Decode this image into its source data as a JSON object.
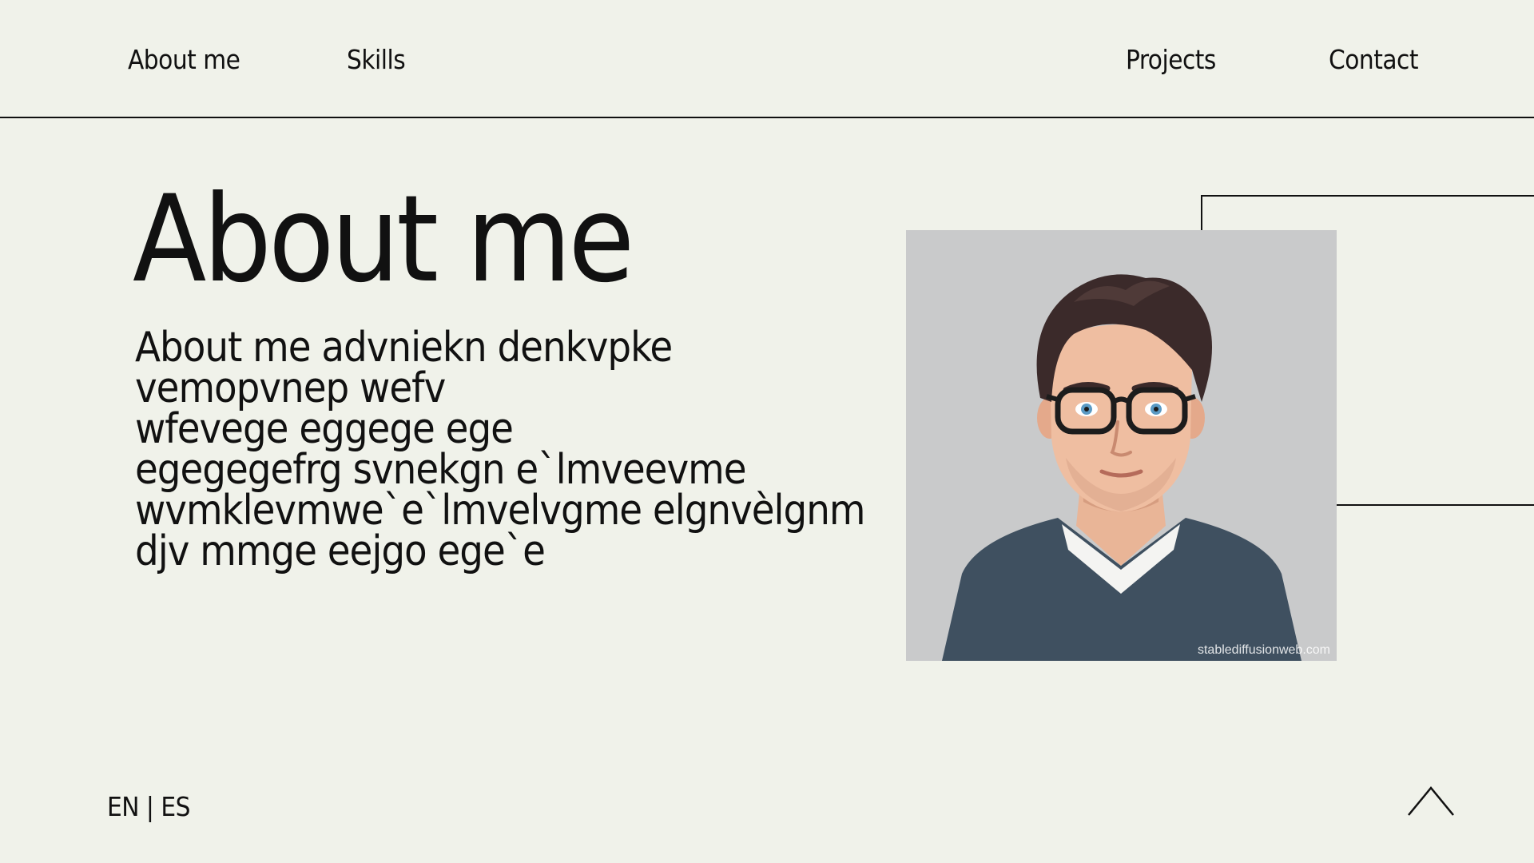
{
  "nav": {
    "about_label": "About me",
    "skills_label": "Skills",
    "projects_label": "Projects",
    "contact_label": "Contact"
  },
  "main": {
    "title": "About me",
    "bio_lines": [
      "About me advniekn denkvpke",
      "vemopvnep wefv",
      "wfevege eggege ege",
      "egegegefrg svnekgn e`lmveevme",
      "wvmklevmwe`e`lmvelvgme elgnvèlgnm",
      "djv mmge eejgo ege`e"
    ],
    "portrait": {
      "icon": "avatar-illustration",
      "watermark": "stablediffusionweb.com"
    }
  },
  "footer": {
    "lang_en": "EN",
    "lang_separator": "|",
    "lang_es": "ES",
    "scroll_top_icon": "chevron-up-icon"
  },
  "colors": {
    "background": "#f0f2ea",
    "text": "#111111",
    "portrait_bg": "#c9cacb",
    "shirt": "#3f5060"
  }
}
